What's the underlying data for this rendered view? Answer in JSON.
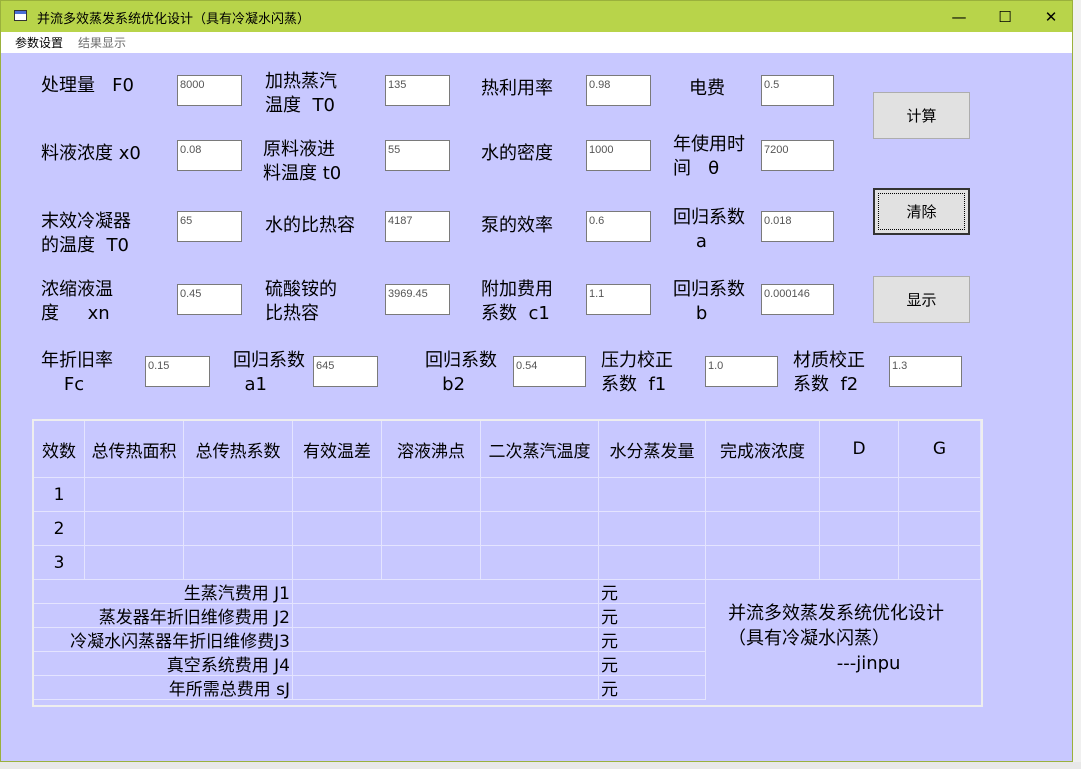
{
  "window": {
    "title": "并流多效蒸发系统优化设计（具有冷凝水闪蒸）",
    "minimize": "—",
    "maximize": "☐",
    "close": "✕"
  },
  "menu": [
    "参数设置",
    "结果显示"
  ],
  "params": {
    "F0": {
      "label": "处理量   F0",
      "value": "8000"
    },
    "T0h": {
      "label": "加热蒸汽\n温度  T0",
      "value": "135"
    },
    "eta": {
      "label": "热利用率",
      "value": "0.98"
    },
    "elec": {
      "label": "电费",
      "value": "0.5"
    },
    "x0": {
      "label": "料液浓度 x0",
      "value": "0.08"
    },
    "t0": {
      "label": "原料液进\n料温度 t0",
      "value": "55"
    },
    "rho": {
      "label": "水的密度",
      "value": "1000"
    },
    "theta": {
      "label": "年使用时\n间   θ",
      "value": "7200"
    },
    "T0c": {
      "label": "末效冷凝器\n的温度  T0",
      "value": "65"
    },
    "cpw": {
      "label": "水的比热容",
      "value": "4187"
    },
    "pump": {
      "label": "泵的效率",
      "value": "0.6"
    },
    "a": {
      "label": "回归系数\n    a",
      "value": "0.018"
    },
    "xn": {
      "label": "浓缩液温\n度     xn",
      "value": "0.45"
    },
    "cps": {
      "label": "硫酸铵的\n比热容",
      "value": "3969.45"
    },
    "c1": {
      "label": "附加费用\n系数  c1",
      "value": "1.1"
    },
    "b": {
      "label": "回归系数\n    b",
      "value": "0.000146"
    },
    "Fc": {
      "label": "年折旧率\n    Fc",
      "value": "0.15"
    },
    "a1": {
      "label": "回归系数\n  a1",
      "value": "645"
    },
    "b2": {
      "label": "回归系数\n   b2",
      "value": "0.54"
    },
    "f1": {
      "label": "压力校正\n系数  f1",
      "value": "1.0"
    },
    "f2": {
      "label": "材质校正\n系数  f2",
      "value": "1.3"
    }
  },
  "buttons": {
    "calc": "计算",
    "clear": "清除",
    "show": "显示"
  },
  "table": {
    "headers": [
      "效数",
      "总传热面积",
      "总传热系数",
      "有效温差",
      "溶液沸点",
      "二次蒸汽温度",
      "水分蒸发量",
      "完成液浓度",
      "D",
      "G"
    ],
    "rows": [
      "1",
      "2",
      "3"
    ],
    "costs": [
      "生蒸汽费用 J1",
      "蒸发器年折旧维修费用 J2",
      "冷凝水闪蒸器年折旧维修费J3",
      "真空系统费用 J4",
      "年所需总费用 sJ"
    ],
    "unit": "元",
    "note": "并流多效蒸发系统优化设计\n（具有冷凝水闪蒸）\n                   ---jinpu"
  },
  "colors": {
    "client_bg": "#c8c8ff",
    "titlebar": "#b8d44a"
  }
}
